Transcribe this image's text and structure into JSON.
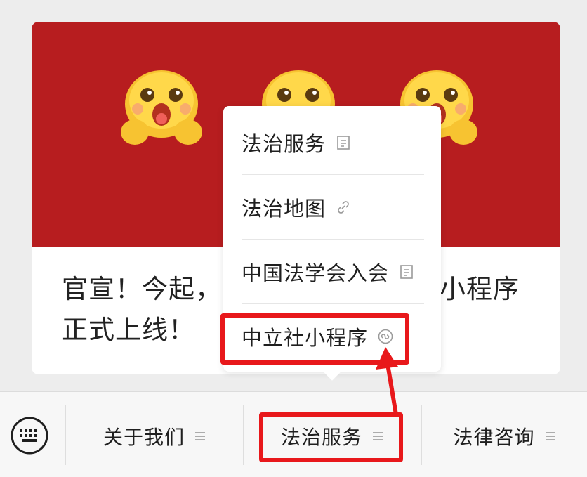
{
  "article": {
    "line1_left": "官宣！今起，",
    "line1_right": "小程序",
    "line2": "正式上线！"
  },
  "popup_menu": {
    "items": [
      {
        "label": "法治服务",
        "icon": "article-icon"
      },
      {
        "label": "法治地图",
        "icon": "link-icon"
      },
      {
        "label": "中国法学会入会",
        "icon": "article-icon"
      },
      {
        "label": "中立社小程序",
        "icon": "mini-program-icon"
      }
    ]
  },
  "bottom_menu": {
    "items": [
      {
        "label": "关于我们",
        "icon": "submenu-lines-icon"
      },
      {
        "label": "法治服务",
        "icon": "submenu-lines-icon"
      },
      {
        "label": "法律咨询",
        "icon": "submenu-lines-icon"
      }
    ]
  },
  "colors": {
    "banner_red": "#b71d1f",
    "highlight_red": "#e8181b",
    "background": "#ededed"
  }
}
